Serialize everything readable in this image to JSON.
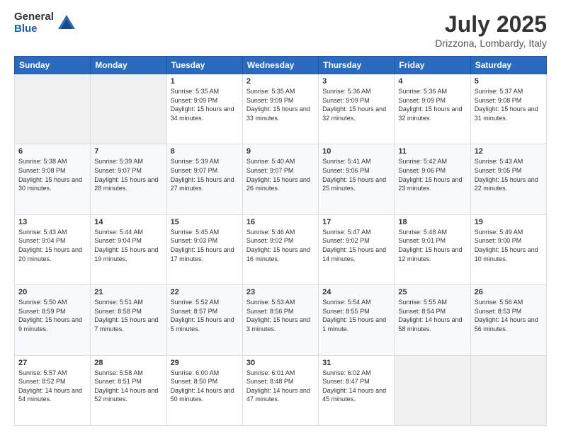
{
  "header": {
    "logo_general": "General",
    "logo_blue": "Blue",
    "month": "July 2025",
    "location": "Drizzona, Lombardy, Italy"
  },
  "days_of_week": [
    "Sunday",
    "Monday",
    "Tuesday",
    "Wednesday",
    "Thursday",
    "Friday",
    "Saturday"
  ],
  "weeks": [
    [
      {
        "day": "",
        "info": ""
      },
      {
        "day": "",
        "info": ""
      },
      {
        "day": "1",
        "info": "Sunrise: 5:35 AM\nSunset: 9:09 PM\nDaylight: 15 hours and 34 minutes."
      },
      {
        "day": "2",
        "info": "Sunrise: 5:35 AM\nSunset: 9:09 PM\nDaylight: 15 hours and 33 minutes."
      },
      {
        "day": "3",
        "info": "Sunrise: 5:36 AM\nSunset: 9:09 PM\nDaylight: 15 hours and 32 minutes."
      },
      {
        "day": "4",
        "info": "Sunrise: 5:36 AM\nSunset: 9:09 PM\nDaylight: 15 hours and 32 minutes."
      },
      {
        "day": "5",
        "info": "Sunrise: 5:37 AM\nSunset: 9:08 PM\nDaylight: 15 hours and 31 minutes."
      }
    ],
    [
      {
        "day": "6",
        "info": "Sunrise: 5:38 AM\nSunset: 9:08 PM\nDaylight: 15 hours and 30 minutes."
      },
      {
        "day": "7",
        "info": "Sunrise: 5:39 AM\nSunset: 9:07 PM\nDaylight: 15 hours and 28 minutes."
      },
      {
        "day": "8",
        "info": "Sunrise: 5:39 AM\nSunset: 9:07 PM\nDaylight: 15 hours and 27 minutes."
      },
      {
        "day": "9",
        "info": "Sunrise: 5:40 AM\nSunset: 9:07 PM\nDaylight: 15 hours and 26 minutes."
      },
      {
        "day": "10",
        "info": "Sunrise: 5:41 AM\nSunset: 9:06 PM\nDaylight: 15 hours and 25 minutes."
      },
      {
        "day": "11",
        "info": "Sunrise: 5:42 AM\nSunset: 9:06 PM\nDaylight: 15 hours and 23 minutes."
      },
      {
        "day": "12",
        "info": "Sunrise: 5:43 AM\nSunset: 9:05 PM\nDaylight: 15 hours and 22 minutes."
      }
    ],
    [
      {
        "day": "13",
        "info": "Sunrise: 5:43 AM\nSunset: 9:04 PM\nDaylight: 15 hours and 20 minutes."
      },
      {
        "day": "14",
        "info": "Sunrise: 5:44 AM\nSunset: 9:04 PM\nDaylight: 15 hours and 19 minutes."
      },
      {
        "day": "15",
        "info": "Sunrise: 5:45 AM\nSunset: 9:03 PM\nDaylight: 15 hours and 17 minutes."
      },
      {
        "day": "16",
        "info": "Sunrise: 5:46 AM\nSunset: 9:02 PM\nDaylight: 15 hours and 16 minutes."
      },
      {
        "day": "17",
        "info": "Sunrise: 5:47 AM\nSunset: 9:02 PM\nDaylight: 15 hours and 14 minutes."
      },
      {
        "day": "18",
        "info": "Sunrise: 5:48 AM\nSunset: 9:01 PM\nDaylight: 15 hours and 12 minutes."
      },
      {
        "day": "19",
        "info": "Sunrise: 5:49 AM\nSunset: 9:00 PM\nDaylight: 15 hours and 10 minutes."
      }
    ],
    [
      {
        "day": "20",
        "info": "Sunrise: 5:50 AM\nSunset: 8:59 PM\nDaylight: 15 hours and 9 minutes."
      },
      {
        "day": "21",
        "info": "Sunrise: 5:51 AM\nSunset: 8:58 PM\nDaylight: 15 hours and 7 minutes."
      },
      {
        "day": "22",
        "info": "Sunrise: 5:52 AM\nSunset: 8:57 PM\nDaylight: 15 hours and 5 minutes."
      },
      {
        "day": "23",
        "info": "Sunrise: 5:53 AM\nSunset: 8:56 PM\nDaylight: 15 hours and 3 minutes."
      },
      {
        "day": "24",
        "info": "Sunrise: 5:54 AM\nSunset: 8:55 PM\nDaylight: 15 hours and 1 minute."
      },
      {
        "day": "25",
        "info": "Sunrise: 5:55 AM\nSunset: 8:54 PM\nDaylight: 14 hours and 58 minutes."
      },
      {
        "day": "26",
        "info": "Sunrise: 5:56 AM\nSunset: 8:53 PM\nDaylight: 14 hours and 56 minutes."
      }
    ],
    [
      {
        "day": "27",
        "info": "Sunrise: 5:57 AM\nSunset: 8:52 PM\nDaylight: 14 hours and 54 minutes."
      },
      {
        "day": "28",
        "info": "Sunrise: 5:58 AM\nSunset: 8:51 PM\nDaylight: 14 hours and 52 minutes."
      },
      {
        "day": "29",
        "info": "Sunrise: 6:00 AM\nSunset: 8:50 PM\nDaylight: 14 hours and 50 minutes."
      },
      {
        "day": "30",
        "info": "Sunrise: 6:01 AM\nSunset: 8:48 PM\nDaylight: 14 hours and 47 minutes."
      },
      {
        "day": "31",
        "info": "Sunrise: 6:02 AM\nSunset: 8:47 PM\nDaylight: 14 hours and 45 minutes."
      },
      {
        "day": "",
        "info": ""
      },
      {
        "day": "",
        "info": ""
      }
    ]
  ]
}
